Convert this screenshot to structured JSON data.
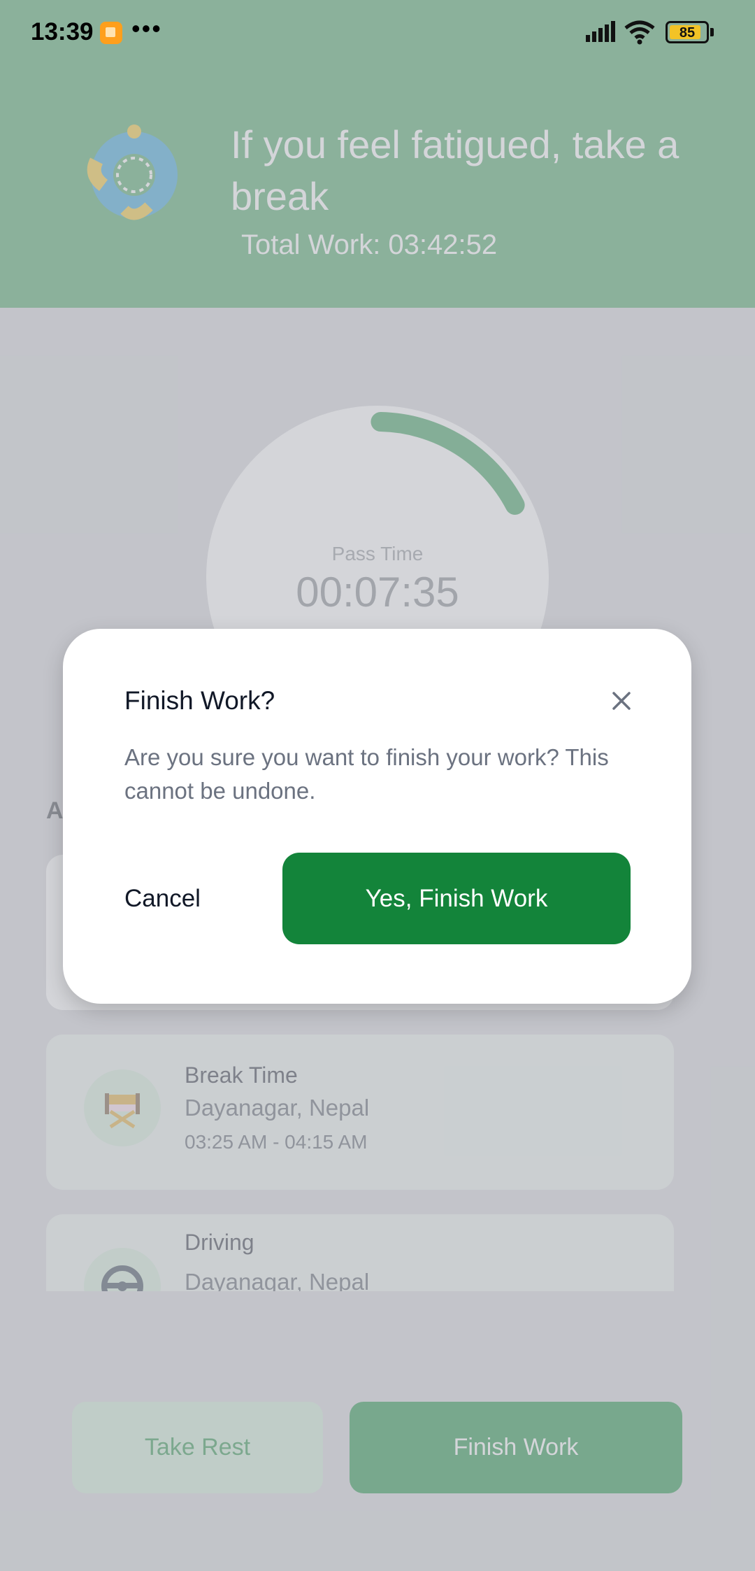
{
  "status_bar": {
    "time": "13:39",
    "dots": "•••",
    "battery": "85"
  },
  "header": {
    "title": "If you feel fatigued, take a break",
    "total_work": "Total Work: 03:42:52"
  },
  "timer": {
    "label": "Pass Time",
    "value": "00:07:35",
    "progress_fraction": 0.17
  },
  "activity": {
    "section_initial": "A",
    "items": [
      {
        "title": "Break Time",
        "location": "Dayanagar, Nepal",
        "time_range": "03:25 AM - 04:15 AM",
        "icon": "chair-icon"
      },
      {
        "title": "Driving",
        "location": "Dayanagar, Nepal",
        "icon": "steering-wheel-icon"
      }
    ]
  },
  "bottom_actions": {
    "rest_label": "Take Rest",
    "finish_label": "Finish Work"
  },
  "dialog": {
    "title": "Finish Work?",
    "message": "Are you sure you want to finish your work? This cannot be undone.",
    "cancel_label": "Cancel",
    "confirm_label": "Yes, Finish Work",
    "close_icon": "close-icon"
  },
  "colors": {
    "brand_green": "#13843a",
    "header_green": "#3fa05e",
    "light_green": "#cbe9d3"
  }
}
